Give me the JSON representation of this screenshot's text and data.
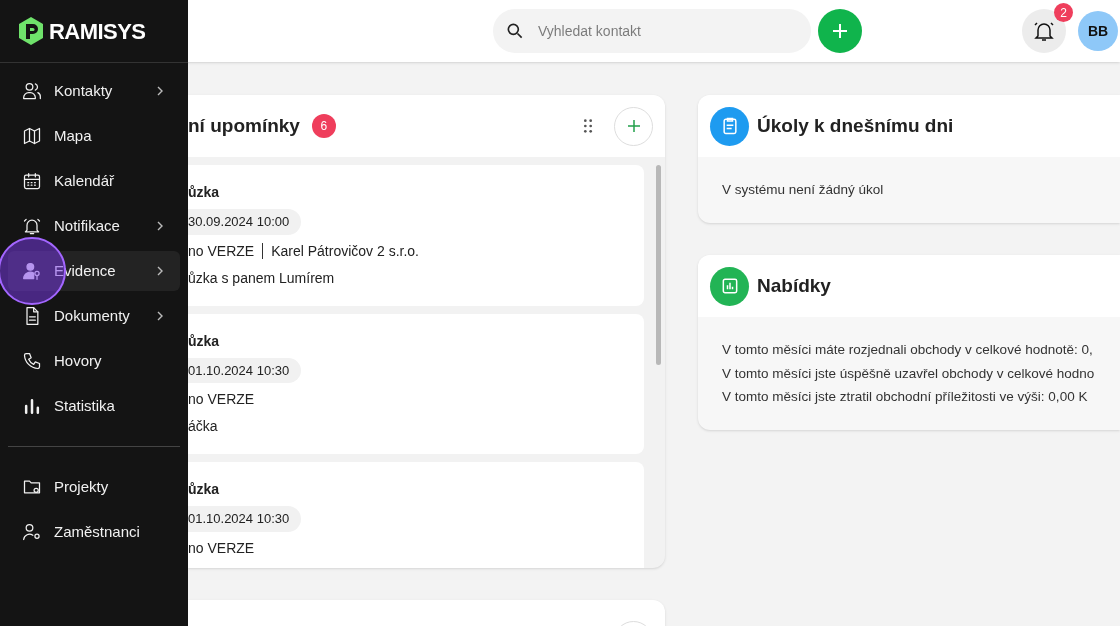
{
  "brand": {
    "name": "RAMISYS"
  },
  "topbar": {
    "search": {
      "placeholder": "Vyhledat kontakt"
    },
    "notifications_badge": "2",
    "avatar": "BB"
  },
  "sidebar": {
    "items": [
      {
        "label": "Kontakty",
        "has_submenu": true,
        "selected": false
      },
      {
        "label": "Mapa",
        "has_submenu": false,
        "selected": false
      },
      {
        "label": "Kalendář",
        "has_submenu": false,
        "selected": false
      },
      {
        "label": "Notifikace",
        "has_submenu": true,
        "selected": false
      },
      {
        "label": "Evidence",
        "has_submenu": true,
        "selected": true
      },
      {
        "label": "Dokumenty",
        "has_submenu": true,
        "selected": false
      },
      {
        "label": "Hovory",
        "has_submenu": false,
        "selected": false
      },
      {
        "label": "Statistika",
        "has_submenu": false,
        "selected": false
      }
    ],
    "bottom_items": [
      {
        "label": "Projekty",
        "has_submenu": false,
        "selected": false
      },
      {
        "label": "Zaměstnanci",
        "has_submenu": false,
        "selected": false
      }
    ]
  },
  "reminders": {
    "title": "ní upomínky",
    "count": "6",
    "items": [
      {
        "title": "ůzka",
        "date": "30.09.2024 10:00",
        "project": "no VERZE",
        "company": "Karel Pátrovičov 2 s.r.o.",
        "note": "ůzka s panem Lumírem"
      },
      {
        "title": "ůzka",
        "date": "01.10.2024 10:30",
        "project": "no VERZE",
        "note": "áčka"
      },
      {
        "title": "ůzka",
        "date": "01.10.2024 10:30",
        "project": "no VERZE"
      }
    ]
  },
  "tasks": {
    "title": "Úkoly k dnešnímu dni",
    "lines": [
      "V systému není žádný úkol"
    ]
  },
  "offers": {
    "title": "Nabídky",
    "lines": [
      "V tomto měsíci máte rozjednali obchody v celkové hodnotě: 0,",
      "V tomto měsíci jste úspěšně uzavřel obchody v celkové hodno",
      "V tomto měsíci jste ztratil obchodní příležitosti ve výši: 0,00 K"
    ]
  }
}
